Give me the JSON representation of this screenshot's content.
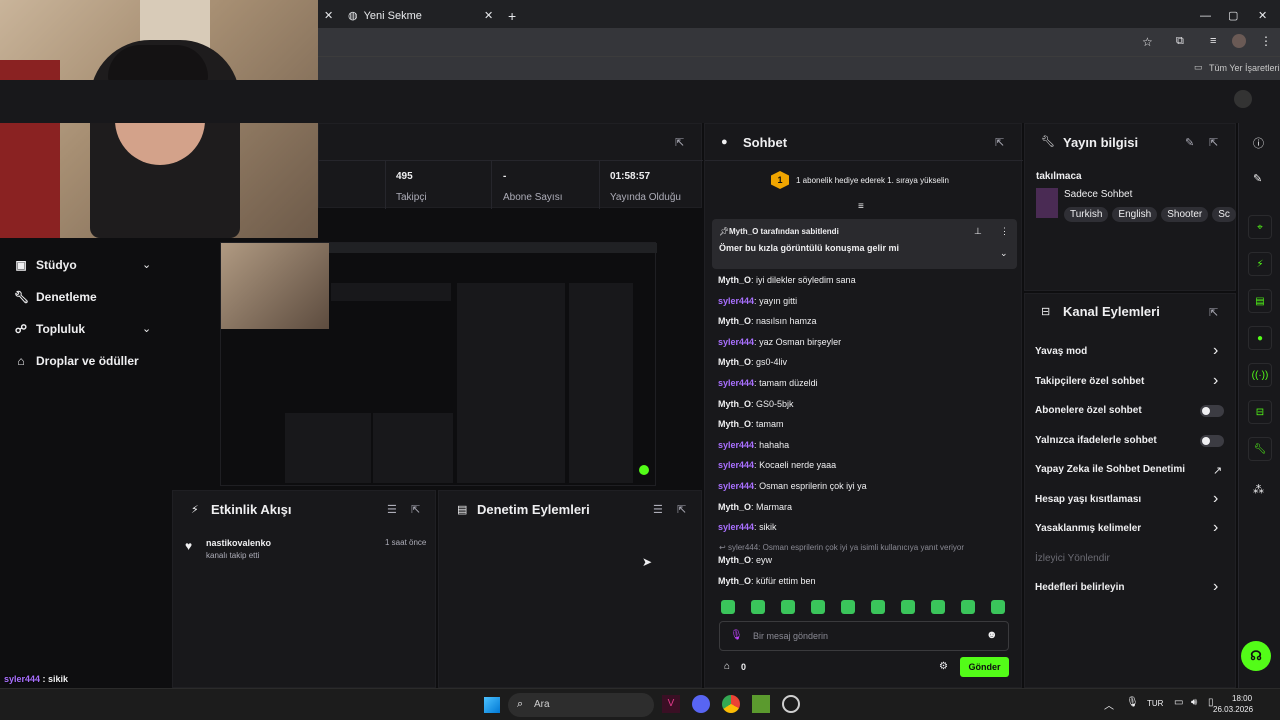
{
  "browser": {
    "tab_title": "Yeni Sekme",
    "bookmarks_label": "Tüm Yer İşaretleri"
  },
  "sidebar": {
    "items": [
      {
        "label": "Stüdyo",
        "icon": "video-icon",
        "has_chevron": true
      },
      {
        "label": "Denetleme",
        "icon": "wrench-icon",
        "has_chevron": false
      },
      {
        "label": "Topluluk",
        "icon": "people-icon",
        "has_chevron": true
      },
      {
        "label": "Droplar ve ödüller",
        "icon": "gift-icon",
        "has_chevron": false
      }
    ]
  },
  "stats": [
    {
      "value": "495",
      "label": "Takipçi"
    },
    {
      "value": "-",
      "label": "Abone Sayısı"
    },
    {
      "value": "01:58:57",
      "label": "Yayında Olduğu"
    }
  ],
  "activity_feed": {
    "title": "Etkinlik Akışı",
    "events": [
      {
        "user": "nastikovalenko",
        "action": "kanalı takip etti",
        "time": "1 saat önce"
      }
    ]
  },
  "moderation": {
    "title": "Denetim Eylemleri"
  },
  "chat": {
    "title": "Sohbet",
    "sub_banner": "1 abonelik hediye ederek 1. sıraya yükselin",
    "sub_rank": "1",
    "pinned_by": "Myth_O tarafından sabitlendi",
    "pinned_message": "Ömer bu kızla görüntülü konuşma gelir mi",
    "messages": [
      {
        "user": "Myth_O",
        "type": "m",
        "text": "iyi dilekler söyledim sana"
      },
      {
        "user": "syler444",
        "type": "s",
        "text": "yayın gitti"
      },
      {
        "user": "Myth_O",
        "type": "m",
        "text": "nasılsın hamza"
      },
      {
        "user": "syler444",
        "type": "s",
        "text": "yaz Osman birşeyler"
      },
      {
        "user": "Myth_O",
        "type": "m",
        "text": "gs0-4liv"
      },
      {
        "user": "syler444",
        "type": "s",
        "text": "tamam düzeldi"
      },
      {
        "user": "Myth_O",
        "type": "m",
        "text": "GS0-5bjk"
      },
      {
        "user": "Myth_O",
        "type": "m",
        "text": "tamam"
      },
      {
        "user": "syler444",
        "type": "s",
        "text": "hahaha"
      },
      {
        "user": "syler444",
        "type": "s",
        "text": "Kocaeli nerde yaaa"
      },
      {
        "user": "syler444",
        "type": "s",
        "text": "Osman esprilerin çok iyi ya"
      },
      {
        "user": "Myth_O",
        "type": "m",
        "text": "Marmara"
      },
      {
        "user": "syler444",
        "type": "s",
        "text": "sikik"
      }
    ],
    "reply_note": "syler444: Osman esprilerin çok iyi ya isimli kullanıcıya yanıt veriyor",
    "reply_messages": [
      {
        "user": "Myth_O",
        "type": "m",
        "text": "eyw"
      },
      {
        "user": "Myth_O",
        "type": "m",
        "text": "küfür ettim ben"
      }
    ],
    "input_placeholder": "Bir mesaj gönderin",
    "points": "0",
    "send_label": "Gönder"
  },
  "stream_info": {
    "title": "Yayın bilgisi",
    "stream_title": "takılmaca",
    "category": "Sadece Sohbet",
    "tags": [
      "Turkish",
      "English",
      "Shooter",
      "Sc"
    ]
  },
  "channel_actions": {
    "title": "Kanal Eylemleri",
    "items": [
      {
        "label": "Yavaş mod",
        "control": "chevron"
      },
      {
        "label": "Takipçilere özel sohbet",
        "control": "chevron"
      },
      {
        "label": "Abonelere özel sohbet",
        "control": "toggle"
      },
      {
        "label": "Yalnızca ifadelerle sohbet",
        "control": "toggle"
      },
      {
        "label": "Yapay Zeka ile Sohbet Denetimi",
        "control": "external"
      },
      {
        "label": "Hesap yaşı kısıtlaması",
        "control": "chevron"
      },
      {
        "label": "Yasaklanmış kelimeler",
        "control": "chevron"
      },
      {
        "label": "İzleyici Yönlendir",
        "control": "disabled"
      },
      {
        "label": "Hedefleri belirleyin",
        "control": "chevron"
      }
    ]
  },
  "overlay_chat": [
    {
      "user": "syler444",
      "text": " : sikik"
    },
    {
      "user": "Myth_O",
      "text": " : eyw"
    },
    {
      "user": "Myth_O",
      "text": " : küfür ettim ben"
    }
  ],
  "taskbar": {
    "search_label": "Ara",
    "language": "TUR",
    "time": "18:00",
    "date": "26.03.2026"
  },
  "colors": {
    "accent_green": "#53fc18",
    "username_purple": "#a970ff",
    "panel_bg": "#18181b"
  }
}
